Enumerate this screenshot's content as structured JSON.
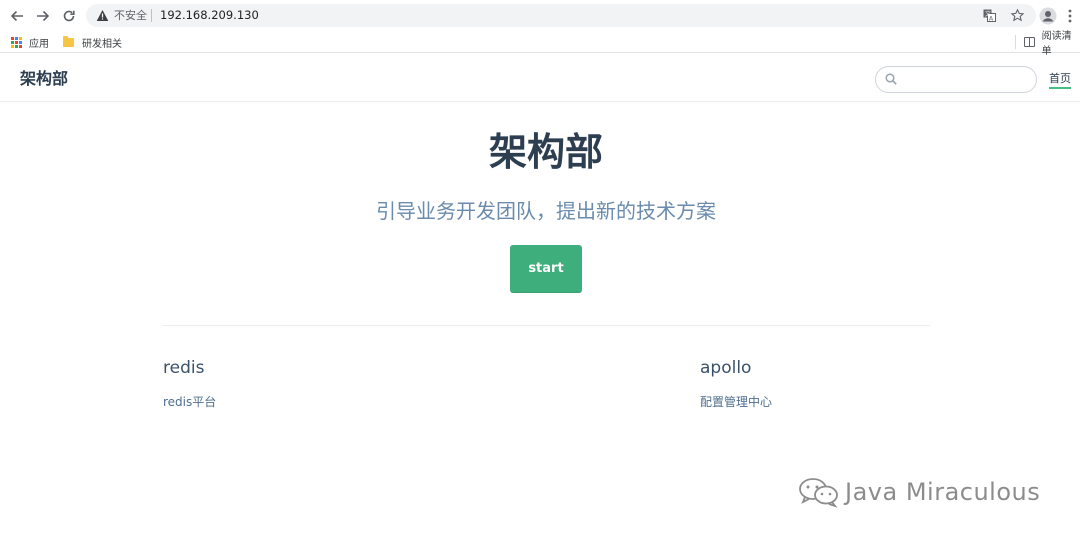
{
  "browser": {
    "security_label": "不安全",
    "url": "192.168.209.130",
    "bookmarks": [
      {
        "label": "应用",
        "icon": "apps-grid-icon"
      },
      {
        "label": "研发相关",
        "icon": "folder-icon"
      }
    ],
    "reading_list_label": "阅读清单",
    "icons": [
      "back-arrow-icon",
      "forward-arrow-icon",
      "reload-icon",
      "warning-icon",
      "translate-icon",
      "star-icon",
      "profile-icon",
      "menu-dots-icon"
    ]
  },
  "site": {
    "title": "架构部",
    "search_placeholder": "",
    "nav": [
      {
        "label": "首页",
        "active": true
      }
    ],
    "accent_color": "#3eaf7c"
  },
  "hero": {
    "title": "架构部",
    "description": "引导业务开发团队，提出新的技术方案",
    "action_label": "start"
  },
  "features": [
    {
      "title": "redis",
      "details": "redis平台"
    },
    {
      "title": "apollo",
      "details": "配置管理中心"
    }
  ],
  "watermark": {
    "text": "Java Miraculous"
  }
}
